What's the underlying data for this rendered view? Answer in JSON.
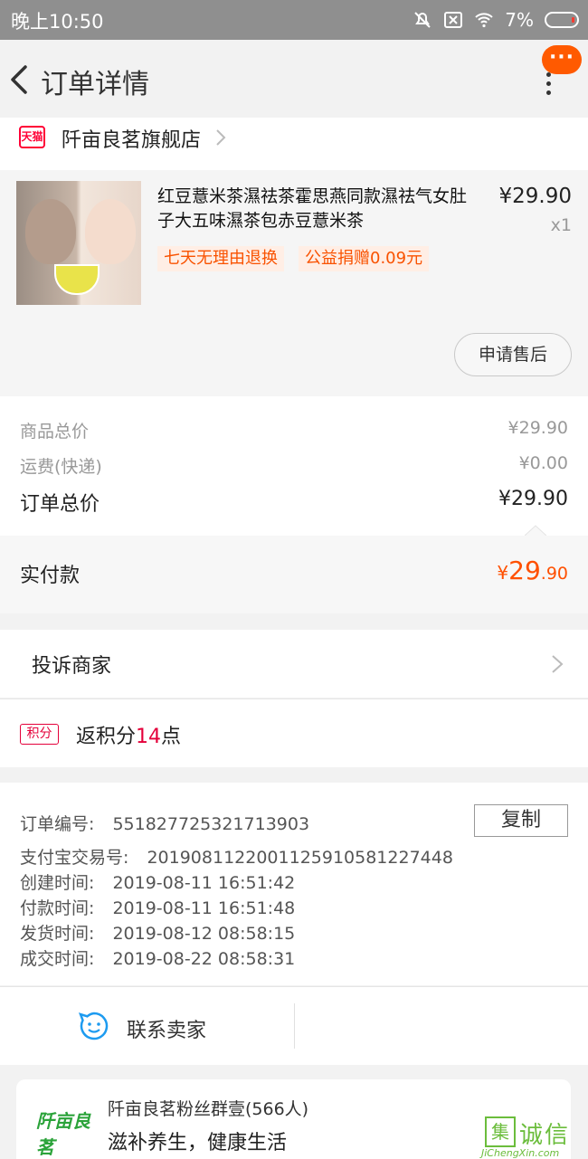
{
  "status_bar": {
    "time": "晚上10:50",
    "battery": "7%"
  },
  "header": {
    "title": "订单详情",
    "more_label": "···"
  },
  "shop": {
    "badge": "天猫",
    "name": "阡亩良茗旗舰店"
  },
  "product": {
    "title": "红豆薏米茶濕祛茶霍思燕同款濕祛气女肚子大五味濕茶包赤豆薏米茶",
    "price": "¥29.90",
    "quantity": "x1",
    "tags": [
      "七天无理由退换",
      "公益捐赠0.09元"
    ],
    "after_sale_label": "申请售后"
  },
  "summary": {
    "goods_total_label": "商品总价",
    "goods_total": "¥29.90",
    "shipping_label": "运费(快递)",
    "shipping": "¥0.00",
    "order_total_label": "订单总价",
    "order_total": "¥29.90",
    "paid_label": "实付款",
    "paid_currency": "¥",
    "paid_integer": "29",
    "paid_decimal": ".90"
  },
  "complaint": {
    "label": "投诉商家"
  },
  "points": {
    "badge": "积分",
    "prefix": "返积分",
    "value": "14",
    "suffix": "点"
  },
  "order_info": {
    "order_no_label": "订单编号:",
    "order_no": "551827725321713903",
    "copy_label": "复制",
    "alipay_label": "支付宝交易号:",
    "alipay_no": "2019081122001125910581227448",
    "created_label": "创建时间:",
    "created": "2019-08-11 16:51:42",
    "paid_time_label": "付款时间:",
    "paid_time": "2019-08-11 16:51:48",
    "shipped_label": "发货时间:",
    "shipped": "2019-08-12 08:58:15",
    "completed_label": "成交时间:",
    "completed": "2019-08-22 08:58:31"
  },
  "contact": {
    "label": "联系卖家"
  },
  "group": {
    "logo_text": "阡亩良茗",
    "name": "阡亩良茗粉丝群壹(566人)",
    "slogan": "滋补养生，健康生活"
  },
  "watermark": {
    "box": "集",
    "chars": "诚信",
    "url": "JiChengXin.com"
  },
  "colors": {
    "accent": "#ff5000",
    "tmall_red": "#ff0036",
    "points_red": "#e4003a"
  }
}
